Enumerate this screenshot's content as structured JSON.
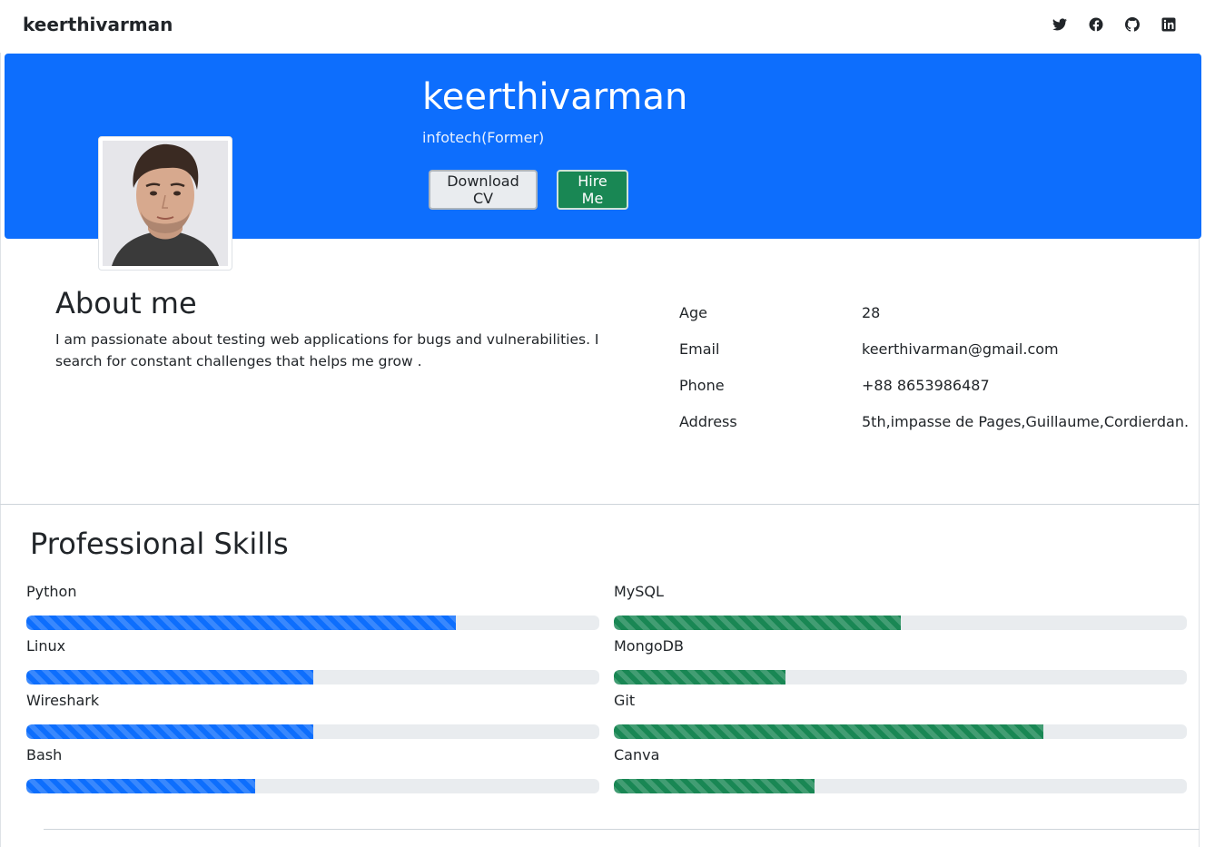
{
  "nav": {
    "brand": "keerthivarman",
    "social_icons": [
      "twitter-icon",
      "facebook-icon",
      "github-icon",
      "linkedin-icon"
    ]
  },
  "hero": {
    "name": "keerthivarman",
    "subtitle": "infotech(Former)",
    "download_label": "Download CV",
    "hire_label": "Hire Me"
  },
  "about": {
    "title": "About me",
    "text": "I am passionate about testing web applications for bugs and vulnerabilities. I search for constant challenges that helps me grow ."
  },
  "info": [
    {
      "label": "Age",
      "value": "28"
    },
    {
      "label": "Email",
      "value": "keerthivarman@gmail.com"
    },
    {
      "label": "Phone",
      "value": "+88 8653986487"
    },
    {
      "label": "Address",
      "value": "5th,impasse de Pages,Guillaume,Cordierdan."
    }
  ],
  "skills": {
    "title": "Professional Skills",
    "left": [
      {
        "name": "Python",
        "percent": 75
      },
      {
        "name": "Linux",
        "percent": 50
      },
      {
        "name": "Wireshark",
        "percent": 50
      },
      {
        "name": "Bash",
        "percent": 40
      }
    ],
    "right": [
      {
        "name": "MySQL",
        "percent": 50
      },
      {
        "name": "MongoDB",
        "percent": 30
      },
      {
        "name": "Git",
        "percent": 75
      },
      {
        "name": "Canva",
        "percent": 35
      }
    ]
  },
  "colors": {
    "primary": "#0d6efd",
    "success": "#198754",
    "track": "#e9ecef"
  }
}
